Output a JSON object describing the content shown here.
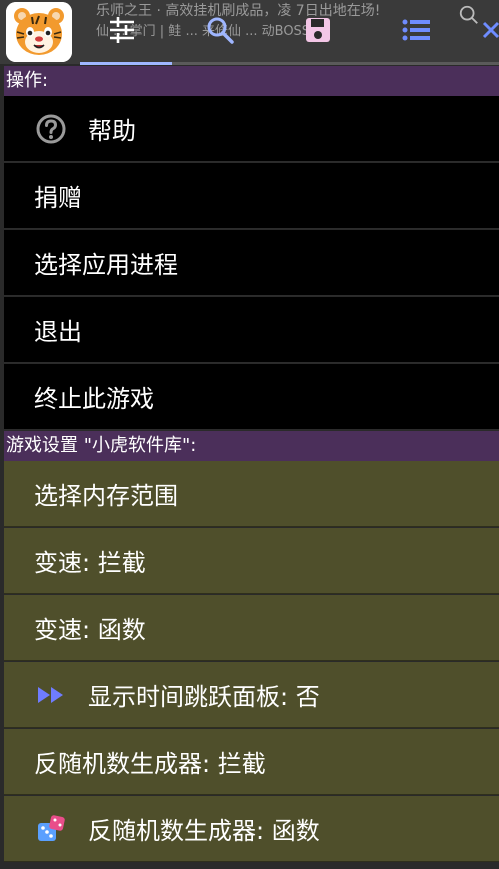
{
  "background": {
    "line1": "乐师之王 · 高效挂机刷成品，凌 7日出地在场!",
    "line2": "仙 ... 掌门 | 鲑 ... 来修仙 ... 动BOSS!"
  },
  "toolbar": {
    "tabs": [
      {
        "icon": "sliders-icon"
      },
      {
        "icon": "search-icon"
      },
      {
        "icon": "save-icon"
      },
      {
        "icon": "list-icon"
      },
      {
        "icon": "close-icon"
      }
    ],
    "colors": {
      "search": "#9fb6ff",
      "save": "#f3c6e6",
      "list": "#6f8cff",
      "indicator": "#9fb6ff"
    }
  },
  "sections": {
    "operations": {
      "header": "操作:",
      "items": [
        {
          "label": "帮助",
          "icon": "help-icon"
        },
        {
          "label": "捐赠"
        },
        {
          "label": "选择应用进程"
        },
        {
          "label": "退出"
        },
        {
          "label": "终止此游戏"
        }
      ]
    },
    "game_settings": {
      "header": "游戏设置 \"小虎软件库\":",
      "items": [
        {
          "label": "选择内存范围"
        },
        {
          "label": "变速: 拦截"
        },
        {
          "label": "变速: 函数"
        },
        {
          "label": "显示时间跳跃面板: 否",
          "icon": "fast-forward-icon"
        },
        {
          "label": "反随机数生成器: 拦截"
        },
        {
          "label": "反随机数生成器: 函数",
          "icon": "dice-icon"
        }
      ]
    }
  },
  "colors": {
    "section_header_bg": "#4b2f5a",
    "operations_bg": "#000000",
    "game_settings_bg": "#4f4f2b",
    "accent_blue": "#6f7cff"
  }
}
